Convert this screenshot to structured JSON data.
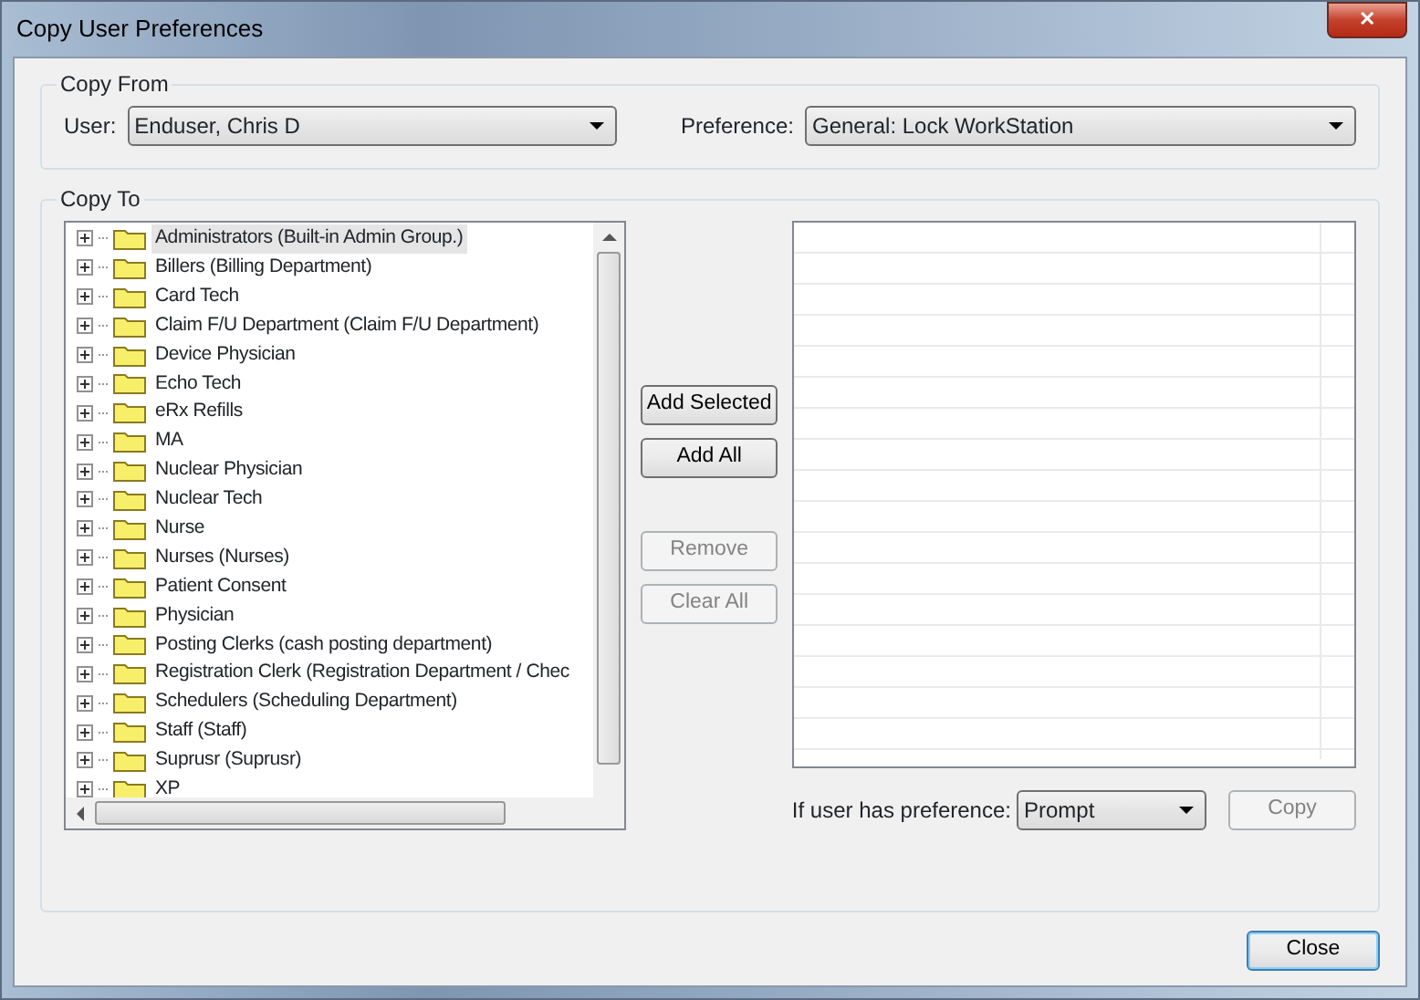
{
  "window": {
    "title": "Copy User Preferences",
    "close_label": "✕"
  },
  "copy_from": {
    "legend": "Copy From",
    "user_label": "User:",
    "user_value": "Enduser, Chris D",
    "preference_label": "Preference:",
    "preference_value": "General: Lock WorkStation"
  },
  "copy_to": {
    "legend": "Copy To",
    "groups": [
      {
        "label": "Administrators (Built-in Admin Group.)",
        "selected": true
      },
      {
        "label": "Billers (Billing Department)",
        "selected": false
      },
      {
        "label": "Card Tech",
        "selected": false
      },
      {
        "label": "Claim F/U Department (Claim F/U Department)",
        "selected": false
      },
      {
        "label": "Device Physician",
        "selected": false
      },
      {
        "label": "Echo Tech",
        "selected": false
      },
      {
        "label": "eRx Refills",
        "selected": false
      },
      {
        "label": "MA",
        "selected": false
      },
      {
        "label": "Nuclear Physician",
        "selected": false
      },
      {
        "label": "Nuclear Tech",
        "selected": false
      },
      {
        "label": "Nurse",
        "selected": false
      },
      {
        "label": "Nurses (Nurses)",
        "selected": false
      },
      {
        "label": "Patient Consent",
        "selected": false
      },
      {
        "label": "Physician",
        "selected": false
      },
      {
        "label": "Posting Clerks (cash posting department)",
        "selected": false
      },
      {
        "label": "Registration Clerk (Registration Department / Chec",
        "selected": false
      },
      {
        "label": "Schedulers (Scheduling Department)",
        "selected": false
      },
      {
        "label": "Staff (Staff)",
        "selected": false
      },
      {
        "label": "Suprusr (Suprusr)",
        "selected": false
      },
      {
        "label": "XP",
        "selected": false
      }
    ],
    "actions": [
      {
        "label": "Add Selected",
        "disabled": false
      },
      {
        "label": "Add All",
        "disabled": false
      },
      {
        "label": "Remove",
        "disabled": true
      },
      {
        "label": "Clear All",
        "disabled": true
      }
    ],
    "conflict_label": "If user has preference:",
    "conflict_value": "Prompt",
    "copy_button": {
      "label": "Copy",
      "disabled": true
    }
  },
  "close_button": "Close"
}
